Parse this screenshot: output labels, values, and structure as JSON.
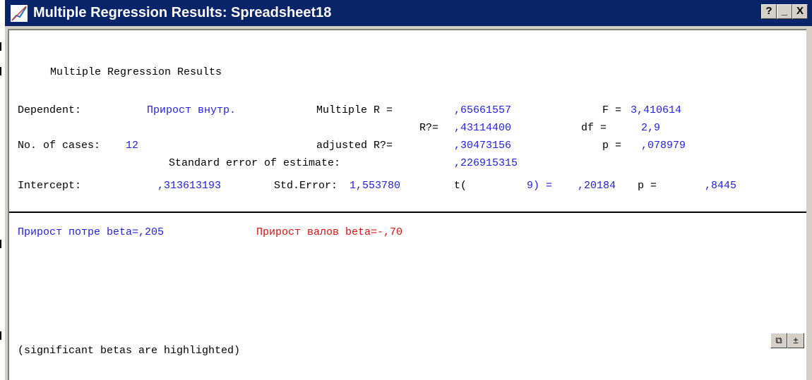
{
  "window": {
    "title": "Multiple Regression Results: Spreadsheet18",
    "buttons": {
      "help": "?",
      "minimize": "_",
      "close": "X"
    }
  },
  "report": {
    "heading": "Multiple Regression Results",
    "dependent_label": "Dependent:",
    "dependent_value": "Прирост внутр.",
    "multiple_r_label": "Multiple R =",
    "multiple_r_value": ",65661557",
    "f_label": "F =",
    "f_value": "3,410614",
    "r2_label": "R?=",
    "r2_value": ",43114400",
    "df_label": "df =",
    "df_value": "2,9",
    "cases_label": "No. of cases:",
    "cases_value": "12",
    "adj_r2_label": "adjusted R?=",
    "adj_r2_value": ",30473156",
    "p_label": "p =",
    "p_value": ",078979",
    "stderr_est_label": "Standard error of estimate:",
    "stderr_est_value": ",226915315",
    "intercept_label": "Intercept:",
    "intercept_value": ",313613193",
    "stderr_label": "Std.Error:",
    "stderr_value": "1,553780",
    "t_label": "t(",
    "t_df": "9) =",
    "t_value": ",20184",
    "p2_label": "p =",
    "p2_value": ",8445",
    "beta1": "Прирост потре beta=,205",
    "beta2": "Прирост валов beta=-,70",
    "footnote": "(significant betas are highlighted)"
  },
  "colors": {
    "title_bg": "#0a246a",
    "value_blue": "#1f1fdf",
    "highlight_red": "#e01010"
  },
  "icons": {
    "window": "statistica-graph-icon",
    "copy": "copy-icon",
    "toggle": "plus-minus-icon"
  }
}
